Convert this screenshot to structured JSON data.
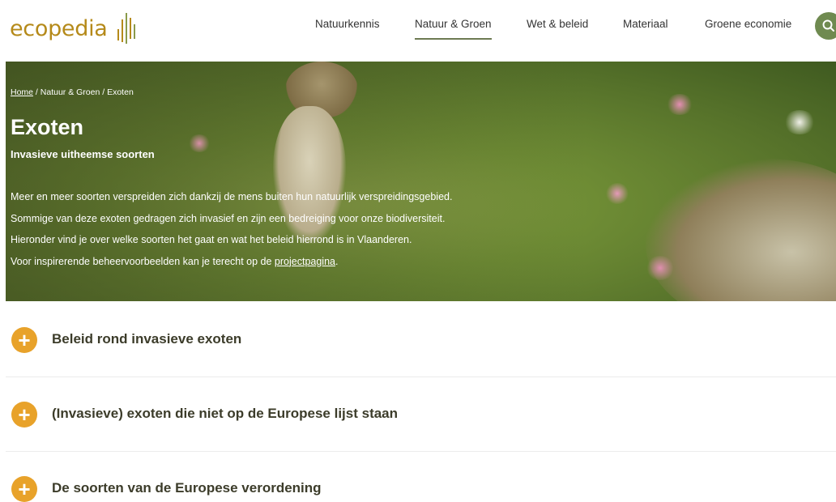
{
  "header": {
    "logo_text": "ecopedia",
    "nav": [
      {
        "label": "Natuurkennis"
      },
      {
        "label": "Natuur & Groen"
      },
      {
        "label": "Wet & beleid"
      },
      {
        "label": "Materiaal"
      },
      {
        "label": "Groene economie"
      }
    ],
    "search_icon": "search-icon",
    "accent_color": "#6f8a50",
    "logo_color": "#b58a1a"
  },
  "hero": {
    "breadcrumb": {
      "home": "Home",
      "sep1": " / ",
      "level1": "Natuur & Groen",
      "sep2": " / ",
      "current": "Exoten"
    },
    "title": "Exoten",
    "subtitle": "Invasieve uitheemse soorten",
    "intro": {
      "line1": "Meer en meer soorten verspreiden zich dankzij de mens buiten hun natuurlijk verspreidingsgebied.",
      "line2": "Sommige van deze exoten gedragen zich invasief en zijn een bedreiging voor onze biodiversiteit.",
      "line3": "Hieronder vind je over welke soorten het gaat en wat het beleid hierrond is in Vlaanderen.",
      "line4_prefix": "Voor inspirerende beheervoorbeelden kan je terecht op de ",
      "line4_link": "projectpagina",
      "line4_suffix": "."
    }
  },
  "accordion": {
    "icon_color": "#e8a22a",
    "items": [
      {
        "label": "Beleid rond invasieve exoten",
        "icon": "plus-icon"
      },
      {
        "label": "(Invasieve) exoten die niet op de Europese lijst staan",
        "icon": "plus-icon"
      },
      {
        "label": "De soorten van de Europese verordening",
        "icon": "plus-icon"
      }
    ]
  }
}
